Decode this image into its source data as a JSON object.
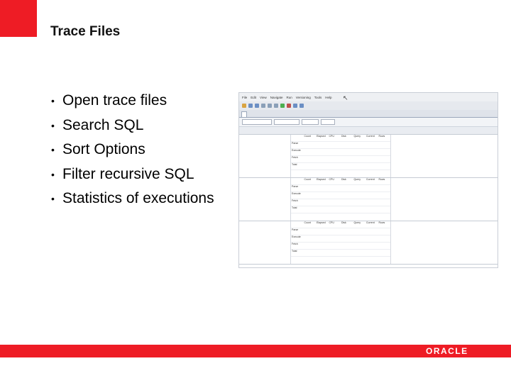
{
  "slide": {
    "title": "Trace Files",
    "bullets": [
      "Open trace files",
      "Search SQL",
      "Sort Options",
      "Filter recursive SQL",
      "Statistics of executions"
    ]
  },
  "brand": {
    "logo_text": "ORACLE",
    "accent_color": "#ee1c25"
  },
  "screenshot": {
    "menu": [
      "File",
      "Edit",
      "View",
      "Navigate",
      "Run",
      "Versioning",
      "Tools",
      "Help"
    ],
    "stat_headers": [
      "Count",
      "Elapsed",
      "CPU",
      "Disk",
      "Query",
      "Current",
      "Rows"
    ],
    "stat_rows": [
      "Parse",
      "Execute",
      "Fetch",
      "Total"
    ]
  }
}
